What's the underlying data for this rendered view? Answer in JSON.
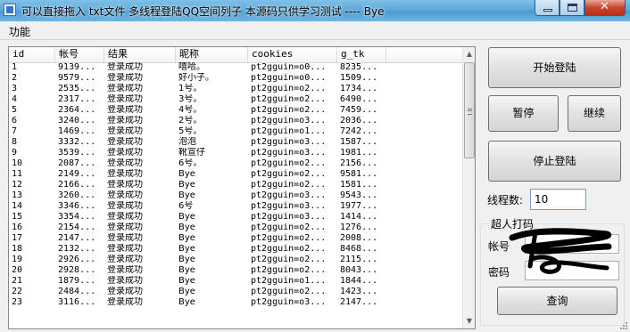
{
  "window": {
    "title": "可以直接拖入 txt文件  多线程登陆QQ空间列子  本源码只供学习测试 ---- Bye"
  },
  "menu": {
    "items": [
      "功能"
    ]
  },
  "list": {
    "columns": [
      "id",
      "帐号",
      "结果",
      "昵称",
      "cookies",
      "g_tk"
    ],
    "rows": [
      [
        "1",
        "9139...",
        "登录成功",
        "嘻哈。",
        "pt2gguin=o0...",
        "8235..."
      ],
      [
        "2",
        "9579...",
        "登录成功",
        "好小子。",
        "pt2gguin=o0...",
        "1509..."
      ],
      [
        "3",
        "2535...",
        "登录成功",
        "1号。",
        "pt2gguin=o2...",
        "1734..."
      ],
      [
        "4",
        "2317...",
        "登录成功",
        "3号。",
        "pt2gguin=o2...",
        "6490..."
      ],
      [
        "5",
        "2364...",
        "登录成功",
        "4号。",
        "pt2gguin=o2...",
        "7459..."
      ],
      [
        "6",
        "3240...",
        "登录成功",
        "2号。",
        "pt2gguin=o3...",
        "2036..."
      ],
      [
        "7",
        "1469...",
        "登录成功",
        "5号。",
        "pt2gguin=o1...",
        "7242..."
      ],
      [
        "8",
        "3332...",
        "登录成功",
        "泡泡",
        "pt2gguin=o3...",
        "1587..."
      ],
      [
        "9",
        "3539...",
        "登录成功",
        "靴宣仔",
        "pt2gguin=o3...",
        "1981..."
      ],
      [
        "10",
        "2087...",
        "登录成功",
        "6号。",
        "pt2gguin=o2...",
        "2156..."
      ],
      [
        "11",
        "2149...",
        "登录成功",
        "Bye",
        "pt2gguin=o2...",
        "9581..."
      ],
      [
        "12",
        "2166...",
        "登录成功",
        "Bye",
        "pt2gguin=o2...",
        "1581..."
      ],
      [
        "13",
        "3260...",
        "登录成功",
        "Bye",
        "pt2gguin=o3...",
        "9543..."
      ],
      [
        "14",
        "3346...",
        "登录成功",
        "6号",
        "pt2gguin=o3...",
        "1977..."
      ],
      [
        "15",
        "3354...",
        "登录成功",
        "Bye",
        "pt2gguin=o3...",
        "1414..."
      ],
      [
        "16",
        "2154...",
        "登录成功",
        "Bye",
        "pt2gguin=o2...",
        "1276..."
      ],
      [
        "17",
        "2147...",
        "登录成功",
        "Bye",
        "pt2gguin=o2...",
        "2008..."
      ],
      [
        "18",
        "2132...",
        "登录成功",
        "Bye",
        "pt2gguin=o2...",
        "8468..."
      ],
      [
        "19",
        "2926...",
        "登录成功",
        "Bye",
        "pt2gguin=o2...",
        "2115..."
      ],
      [
        "20",
        "2928...",
        "登录成功",
        "Bye",
        "pt2gguin=o2...",
        "8043..."
      ],
      [
        "21",
        "1879...",
        "登录成功",
        "Bye",
        "pt2gguin=o1...",
        "1844..."
      ],
      [
        "22",
        "2484...",
        "登录成功",
        "Bye",
        "pt2gguin=o2...",
        "1423..."
      ],
      [
        "23",
        "3116...",
        "登录成功",
        "Bye",
        "pt2gguin=o3...",
        "2147..."
      ]
    ]
  },
  "buttons": {
    "start": "开始登陆",
    "pause": "暂停",
    "resume": "继续",
    "stop": "停止登陆",
    "query": "查询"
  },
  "threads": {
    "label": "线程数:",
    "value": "10"
  },
  "captcha": {
    "title": "超人打码",
    "account_label": "帐号",
    "password_label": "密码"
  },
  "colors": {
    "titlebar": "#5aa9db",
    "close": "#c9452e"
  }
}
